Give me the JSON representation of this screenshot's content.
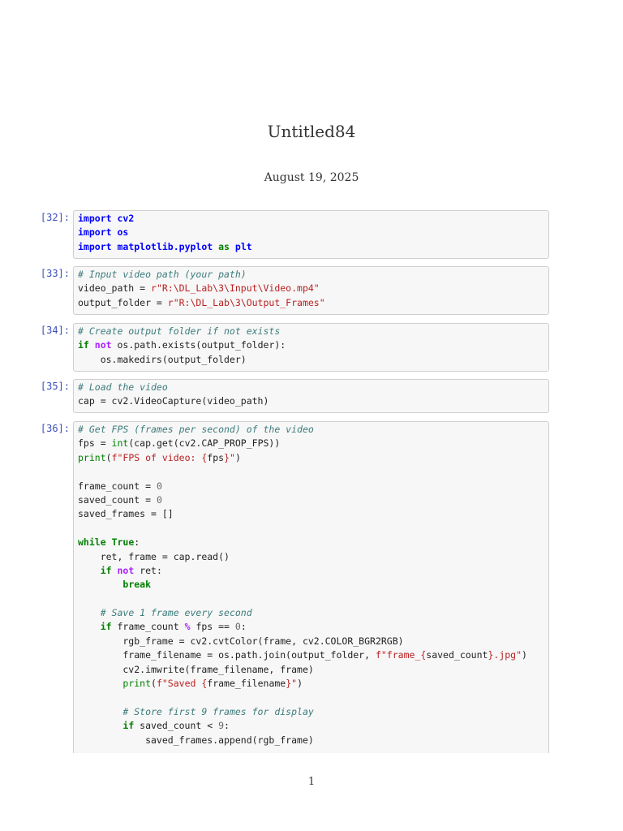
{
  "document": {
    "title": "Untitled84",
    "date": "August 19, 2025",
    "page_number": "1"
  },
  "cells": [
    {
      "prompt": "[32]:",
      "lines": [
        [
          [
            "import",
            "nm"
          ],
          [
            " ",
            ""
          ],
          [
            "cv2",
            "nm"
          ]
        ],
        [
          [
            "import",
            "nm"
          ],
          [
            " ",
            ""
          ],
          [
            "os",
            "nm"
          ]
        ],
        [
          [
            "import",
            "nm"
          ],
          [
            " ",
            ""
          ],
          [
            "matplotlib.pyplot",
            "nm"
          ],
          [
            " ",
            ""
          ],
          [
            "as",
            "kw"
          ],
          [
            " ",
            ""
          ],
          [
            "plt",
            "nm"
          ]
        ]
      ]
    },
    {
      "prompt": "[33]:",
      "lines": [
        [
          [
            "# Input video path (your path)",
            "cm"
          ]
        ],
        [
          [
            "video_path = ",
            ""
          ],
          [
            "r\"R:\\DL_Lab\\3\\Input\\Video.mp4\"",
            "str"
          ]
        ],
        [
          [
            "output_folder = ",
            ""
          ],
          [
            "r\"R:\\DL_Lab\\3\\Output_Frames\"",
            "str"
          ]
        ]
      ]
    },
    {
      "prompt": "[34]:",
      "lines": [
        [
          [
            "# Create output folder if not exists",
            "cm"
          ]
        ],
        [
          [
            "if",
            "kw"
          ],
          [
            " ",
            ""
          ],
          [
            "not",
            "kw2"
          ],
          [
            " os.path.exists(output_folder):",
            ""
          ]
        ],
        [
          [
            "    os.makedirs(output_folder)",
            ""
          ]
        ]
      ]
    },
    {
      "prompt": "[35]:",
      "lines": [
        [
          [
            "# Load the video",
            "cm"
          ]
        ],
        [
          [
            "cap = cv2.VideoCapture(video_path)",
            ""
          ]
        ]
      ]
    },
    {
      "prompt": "[36]:",
      "lines": [
        [
          [
            "# Get FPS (frames per second) of the video",
            "cm"
          ]
        ],
        [
          [
            "fps = ",
            ""
          ],
          [
            "int",
            "bi"
          ],
          [
            "(cap.get(cv2.CAP_PROP_FPS))",
            ""
          ]
        ],
        [
          [
            "print",
            "bi"
          ],
          [
            "(",
            ""
          ],
          [
            "f\"FPS of video: ",
            "str"
          ],
          [
            "{",
            "str"
          ],
          [
            "fps",
            ""
          ],
          [
            "}",
            "str"
          ],
          [
            "\"",
            "str"
          ],
          [
            ")",
            ""
          ]
        ],
        [
          [
            "",
            ""
          ]
        ],
        [
          [
            "frame_count = ",
            ""
          ],
          [
            "0",
            "num"
          ]
        ],
        [
          [
            "saved_count = ",
            ""
          ],
          [
            "0",
            "num"
          ]
        ],
        [
          [
            "saved_frames = []",
            ""
          ]
        ],
        [
          [
            "",
            ""
          ]
        ],
        [
          [
            "while",
            "kw"
          ],
          [
            " ",
            ""
          ],
          [
            "True",
            "kw"
          ],
          [
            ":",
            ""
          ]
        ],
        [
          [
            "    ret, frame = cap.read()",
            ""
          ]
        ],
        [
          [
            "    ",
            ""
          ],
          [
            "if",
            "kw"
          ],
          [
            " ",
            ""
          ],
          [
            "not",
            "kw2"
          ],
          [
            " ret:",
            ""
          ]
        ],
        [
          [
            "        ",
            ""
          ],
          [
            "break",
            "kw"
          ]
        ],
        [
          [
            "",
            ""
          ]
        ],
        [
          [
            "    ",
            ""
          ],
          [
            "# Save 1 frame every second",
            "cm"
          ]
        ],
        [
          [
            "    ",
            ""
          ],
          [
            "if",
            "kw"
          ],
          [
            " frame_count ",
            ""
          ],
          [
            "%",
            "kw2"
          ],
          [
            " fps == ",
            ""
          ],
          [
            "0",
            "num"
          ],
          [
            ":",
            ""
          ]
        ],
        [
          [
            "        rgb_frame = cv2.cvtColor(frame, cv2.COLOR_BGR2RGB)",
            ""
          ]
        ],
        [
          [
            "        frame_filename = os.path.join(output_folder, ",
            ""
          ],
          [
            "f\"frame_",
            "str"
          ],
          [
            "{",
            "str"
          ],
          [
            "saved_count",
            ""
          ],
          [
            "}",
            "str"
          ],
          [
            ".jpg\"",
            "str"
          ],
          [
            ")",
            ""
          ]
        ],
        [
          [
            "        cv2.imwrite(frame_filename, frame)",
            ""
          ]
        ],
        [
          [
            "        ",
            ""
          ],
          [
            "print",
            "bi"
          ],
          [
            "(",
            ""
          ],
          [
            "f\"Saved ",
            "str"
          ],
          [
            "{",
            "str"
          ],
          [
            "frame_filename",
            ""
          ],
          [
            "}",
            "str"
          ],
          [
            "\"",
            "str"
          ],
          [
            ")",
            ""
          ]
        ],
        [
          [
            "",
            ""
          ]
        ],
        [
          [
            "        ",
            ""
          ],
          [
            "# Store first 9 frames for display",
            "cm"
          ]
        ],
        [
          [
            "        ",
            ""
          ],
          [
            "if",
            "kw"
          ],
          [
            " saved_count < ",
            ""
          ],
          [
            "9",
            "num"
          ],
          [
            ":",
            ""
          ]
        ],
        [
          [
            "            saved_frames.append(rgb_frame)",
            ""
          ]
        ]
      ]
    }
  ]
}
